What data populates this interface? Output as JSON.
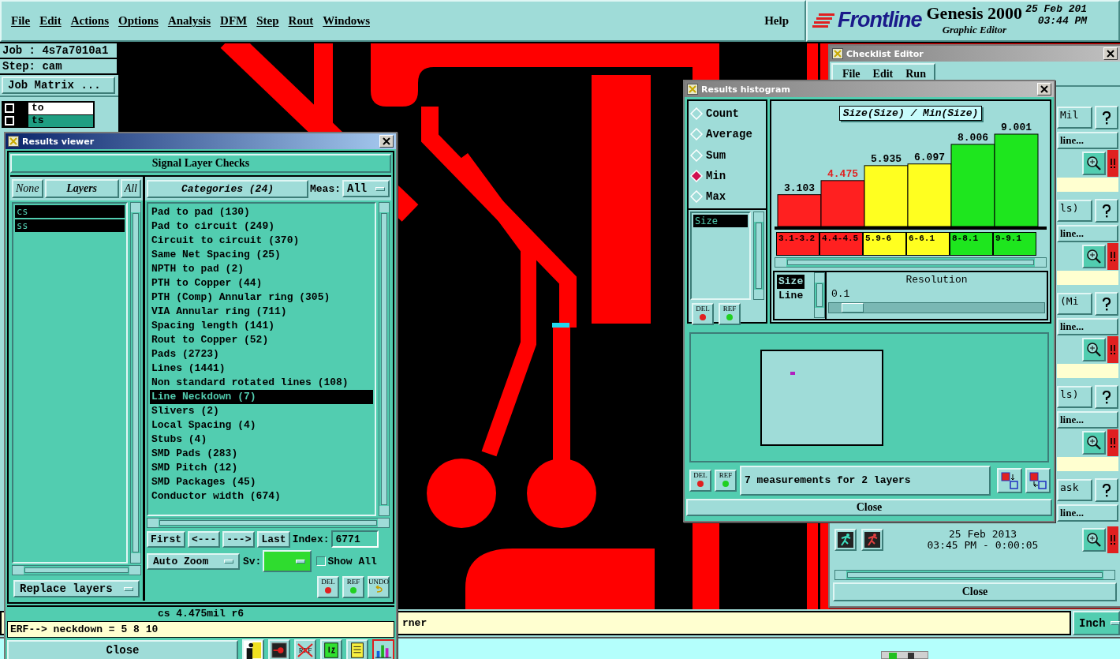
{
  "menu": {
    "items": [
      "File",
      "Edit",
      "Actions",
      "Options",
      "Analysis",
      "DFM",
      "Step",
      "Rout",
      "Windows"
    ],
    "help": "Help"
  },
  "brand": {
    "logo": "Frontline",
    "product": "Genesis 2000",
    "subtitle": "Graphic Editor",
    "date": "25 Feb 201",
    "time": "03:44 PM"
  },
  "job_panel": {
    "job": "Job : 4s7a7010a1",
    "step": "Step: cam",
    "matrix_button": "Job Matrix ...",
    "layers": [
      {
        "name": "to",
        "selected": false
      },
      {
        "name": "ts",
        "selected": true
      }
    ]
  },
  "status_bar": {
    "message": "rner",
    "unit": "Inch"
  },
  "results_viewer": {
    "title": "Results viewer",
    "check_set": "Signal Layer Checks",
    "none": "None",
    "layers_title": "Layers",
    "all": "All",
    "layers": [
      {
        "name": "cs",
        "selected": true
      },
      {
        "name": "ss",
        "selected": true
      }
    ],
    "categories_button": "Categories (24)",
    "meas_label": "Meas:",
    "meas_value": "All",
    "categories": [
      {
        "label": "Pad to pad (130)",
        "selected": false
      },
      {
        "label": "Pad to circuit (249)",
        "selected": false
      },
      {
        "label": "Circuit to circuit (370)",
        "selected": false
      },
      {
        "label": "Same Net Spacing (25)",
        "selected": false
      },
      {
        "label": "NPTH to pad (2)",
        "selected": false
      },
      {
        "label": "PTH to Copper (44)",
        "selected": false
      },
      {
        "label": "PTH (Comp) Annular ring (305)",
        "selected": false
      },
      {
        "label": "VIA Annular ring (711)",
        "selected": false
      },
      {
        "label": "Spacing length (141)",
        "selected": false
      },
      {
        "label": "Rout to Copper (52)",
        "selected": false
      },
      {
        "label": "Pads (2723)",
        "selected": false
      },
      {
        "label": "Lines (1441)",
        "selected": false
      },
      {
        "label": "Non standard rotated lines (108)",
        "selected": false
      },
      {
        "label": "Line Neckdown (7)",
        "selected": true
      },
      {
        "label": "Slivers (2)",
        "selected": false
      },
      {
        "label": "Local Spacing (4)",
        "selected": false
      },
      {
        "label": "Stubs (4)",
        "selected": false
      },
      {
        "label": "SMD Pads (283)",
        "selected": false
      },
      {
        "label": "SMD Pitch (12)",
        "selected": false
      },
      {
        "label": "SMD Packages (45)",
        "selected": false
      },
      {
        "label": "Conductor width (674)",
        "selected": false
      }
    ],
    "nav": [
      "First",
      "<---",
      "--->",
      "Last"
    ],
    "index_label": "Index:",
    "index_value": "6771",
    "zoom_mode": "Auto Zoom",
    "sv_label": "Sv:",
    "show_all": {
      "label": "Show All",
      "checked": false
    },
    "replace": "Replace layers",
    "del": "DEL",
    "ref": "REF",
    "undo": "UNDO",
    "readout": "cs 4.475mil  r6",
    "command": "ERF--> neckdown = 5 8 10",
    "close": "Close",
    "tools": [
      {
        "kind": "figure",
        "selected": false
      },
      {
        "kind": "target",
        "selected": false
      },
      {
        "kind": "ref-off",
        "label": "REF",
        "selected": false
      },
      {
        "kind": "pages",
        "selected": false
      },
      {
        "kind": "note",
        "selected": false
      },
      {
        "kind": "chart",
        "selected": true
      }
    ]
  },
  "histogram": {
    "title": "Results histogram",
    "modes": [
      {
        "label": "Count",
        "selected": false
      },
      {
        "label": "Average",
        "selected": false
      },
      {
        "label": "Sum",
        "selected": false
      },
      {
        "label": "Min",
        "selected": true
      },
      {
        "label": "Max",
        "selected": false
      }
    ],
    "fields": [
      {
        "label": "Size",
        "selected": true
      }
    ],
    "list_del": "DEL",
    "list_ref": "REF",
    "chart_data": {
      "type": "bar",
      "title": "Size(Size) / Min(Size)",
      "categories": [
        "3.1-3.2",
        "4.4-4.5",
        "5.9-6",
        "6-6.1",
        "8-8.1",
        "9-9.1"
      ],
      "values": [
        3.103,
        4.475,
        5.935,
        6.097,
        8.006,
        9.001
      ],
      "data_labels": true
    },
    "bins": [
      {
        "color": "#ff2020",
        "selected": false
      },
      {
        "color": "#ff2020",
        "selected": true
      },
      {
        "color": "#ffff20",
        "selected": false
      },
      {
        "color": "#ffff20",
        "selected": false
      },
      {
        "color": "#1ee61e",
        "selected": false
      },
      {
        "color": "#1ee61e",
        "selected": false
      }
    ],
    "resolution": {
      "fields": [
        {
          "label": "Size",
          "selected": true
        },
        {
          "label": "Line",
          "selected": false
        }
      ],
      "title": "Resolution",
      "value": "0.1",
      "level": 0.06
    },
    "status_del": "DEL",
    "status_ref": "REF",
    "message": "7 measurements for 2 layers",
    "close": "Close"
  },
  "checklist_editor": {
    "title": "Checklist Editor",
    "menu": [
      "File",
      "Edit",
      "Run"
    ],
    "rows": [
      {
        "label": "Mil",
        "button": "line..."
      },
      {
        "label": "ls)",
        "button": "line..."
      },
      {
        "label": "(Mi",
        "button": "line..."
      },
      {
        "label": "ls)",
        "button": "line..."
      },
      {
        "label": "ask",
        "button": "line..."
      }
    ],
    "date": "25 Feb 2013",
    "time": "03:45 PM - 0:00:05",
    "close": "Close"
  }
}
